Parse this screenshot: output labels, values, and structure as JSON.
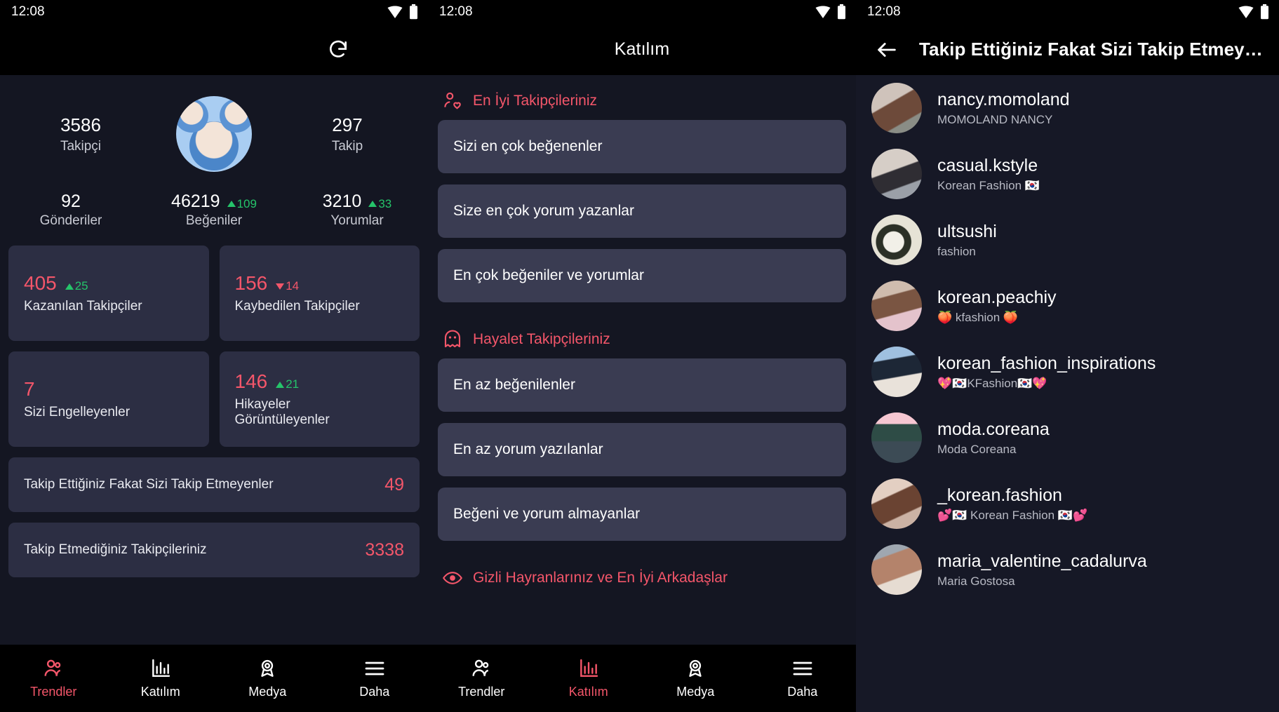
{
  "statusbar": {
    "time": "12:08",
    "wifi_icon": "wifi-icon",
    "battery_icon": "battery-icon"
  },
  "left_screen": {
    "appbar": {
      "refresh_icon": "refresh-icon"
    },
    "profile": {
      "followers": {
        "value": "3586",
        "label": "Takipçi"
      },
      "following": {
        "value": "297",
        "label": "Takip"
      },
      "avatar": "profile-avatar"
    },
    "metrics": [
      {
        "value": "92",
        "label": "Gönderiler",
        "delta": "",
        "dir": "none"
      },
      {
        "value": "46219",
        "label": "Beğeniler",
        "delta": "109",
        "dir": "up"
      },
      {
        "value": "3210",
        "label": "Yorumlar",
        "delta": "33",
        "dir": "up"
      }
    ],
    "cards": [
      {
        "value": "405",
        "label": "Kazanılan Takipçiler",
        "delta": "25",
        "dir": "up"
      },
      {
        "value": "156",
        "label": "Kaybedilen Takipçiler",
        "delta": "14",
        "dir": "down"
      },
      {
        "value": "7",
        "label": "Sizi Engelleyenler",
        "delta": "",
        "dir": "none"
      },
      {
        "value": "146",
        "label": "Hikayeler\nGörüntüleyenler",
        "delta": "21",
        "dir": "up"
      }
    ],
    "wide_rows": [
      {
        "label": "Takip Ettiğiniz Fakat Sizi Takip Etmeyenler",
        "count": "49"
      },
      {
        "label": "Takip Etmediğiniz Takipçileriniz",
        "count": "3338"
      }
    ],
    "nav": [
      {
        "label": "Trendler",
        "icon": "people-icon",
        "active": true
      },
      {
        "label": "Katılım",
        "icon": "bar-chart-icon",
        "active": false
      },
      {
        "label": "Medya",
        "icon": "award-icon",
        "active": false
      },
      {
        "label": "Daha",
        "icon": "menu-icon",
        "active": false
      }
    ]
  },
  "middle_screen": {
    "appbar": {
      "title": "Katılım"
    },
    "sections": [
      {
        "title": "En İyi Takipçileriniz",
        "icon": "person-heart-icon",
        "items": [
          {
            "label": "Sizi en çok beğenenler"
          },
          {
            "label": "Size en çok yorum yazanlar"
          },
          {
            "label": "En çok beğeniler ve yorumlar"
          }
        ]
      },
      {
        "title": "Hayalet Takipçileriniz",
        "icon": "ghost-icon",
        "items": [
          {
            "label": "En az beğenilenler"
          },
          {
            "label": "En az yorum yazılanlar"
          },
          {
            "label": "Beğeni ve yorum almayanlar"
          }
        ]
      },
      {
        "title": "Gizli Hayranlarınız ve En İyi Arkadaşlar",
        "icon": "eye-icon",
        "items": []
      }
    ],
    "nav": [
      {
        "label": "Trendler",
        "icon": "people-icon",
        "active": false
      },
      {
        "label": "Katılım",
        "icon": "bar-chart-icon",
        "active": true
      },
      {
        "label": "Medya",
        "icon": "award-icon",
        "active": false
      },
      {
        "label": "Daha",
        "icon": "menu-icon",
        "active": false
      }
    ]
  },
  "right_screen": {
    "appbar": {
      "back_icon": "back-arrow-icon",
      "title": "Takip Ettiğiniz Fakat Sizi Takip Etmey…"
    },
    "users": [
      {
        "username": "nancy.momoland",
        "bio": "MOMOLAND NANCY",
        "avatar_color": "#b9a89e"
      },
      {
        "username": "casual.kstyle",
        "bio": "Korean Fashion 🇰🇷",
        "avatar_color": "#c3b7ad"
      },
      {
        "username": "ultsushi",
        "bio": "fashion",
        "avatar_color": "#dcdad0"
      },
      {
        "username": "korean.peachiy",
        "bio": "🍑 kfashion 🍑",
        "avatar_color": "#c9b3a6"
      },
      {
        "username": "korean_fashion_inspirations",
        "bio": "💖🇰🇷KFashion🇰🇷💖",
        "avatar_color": "#6e8cb8"
      },
      {
        "username": "moda.coreana",
        "bio": "Moda Coreana",
        "avatar_color": "#f2c3cd"
      },
      {
        "username": "_korean.fashion",
        "bio": "💕🇰🇷 Korean Fashion 🇰🇷💕",
        "avatar_color": "#cdaf9e"
      },
      {
        "username": "maria_valentine_cadalurva",
        "bio": "Maria Gostosa",
        "avatar_color": "#b0a096"
      }
    ]
  },
  "colors": {
    "accent": "#f4566a",
    "up": "#25c46a",
    "card": "#2c2e43",
    "mcard": "#3a3c52",
    "bg": "#141622"
  }
}
